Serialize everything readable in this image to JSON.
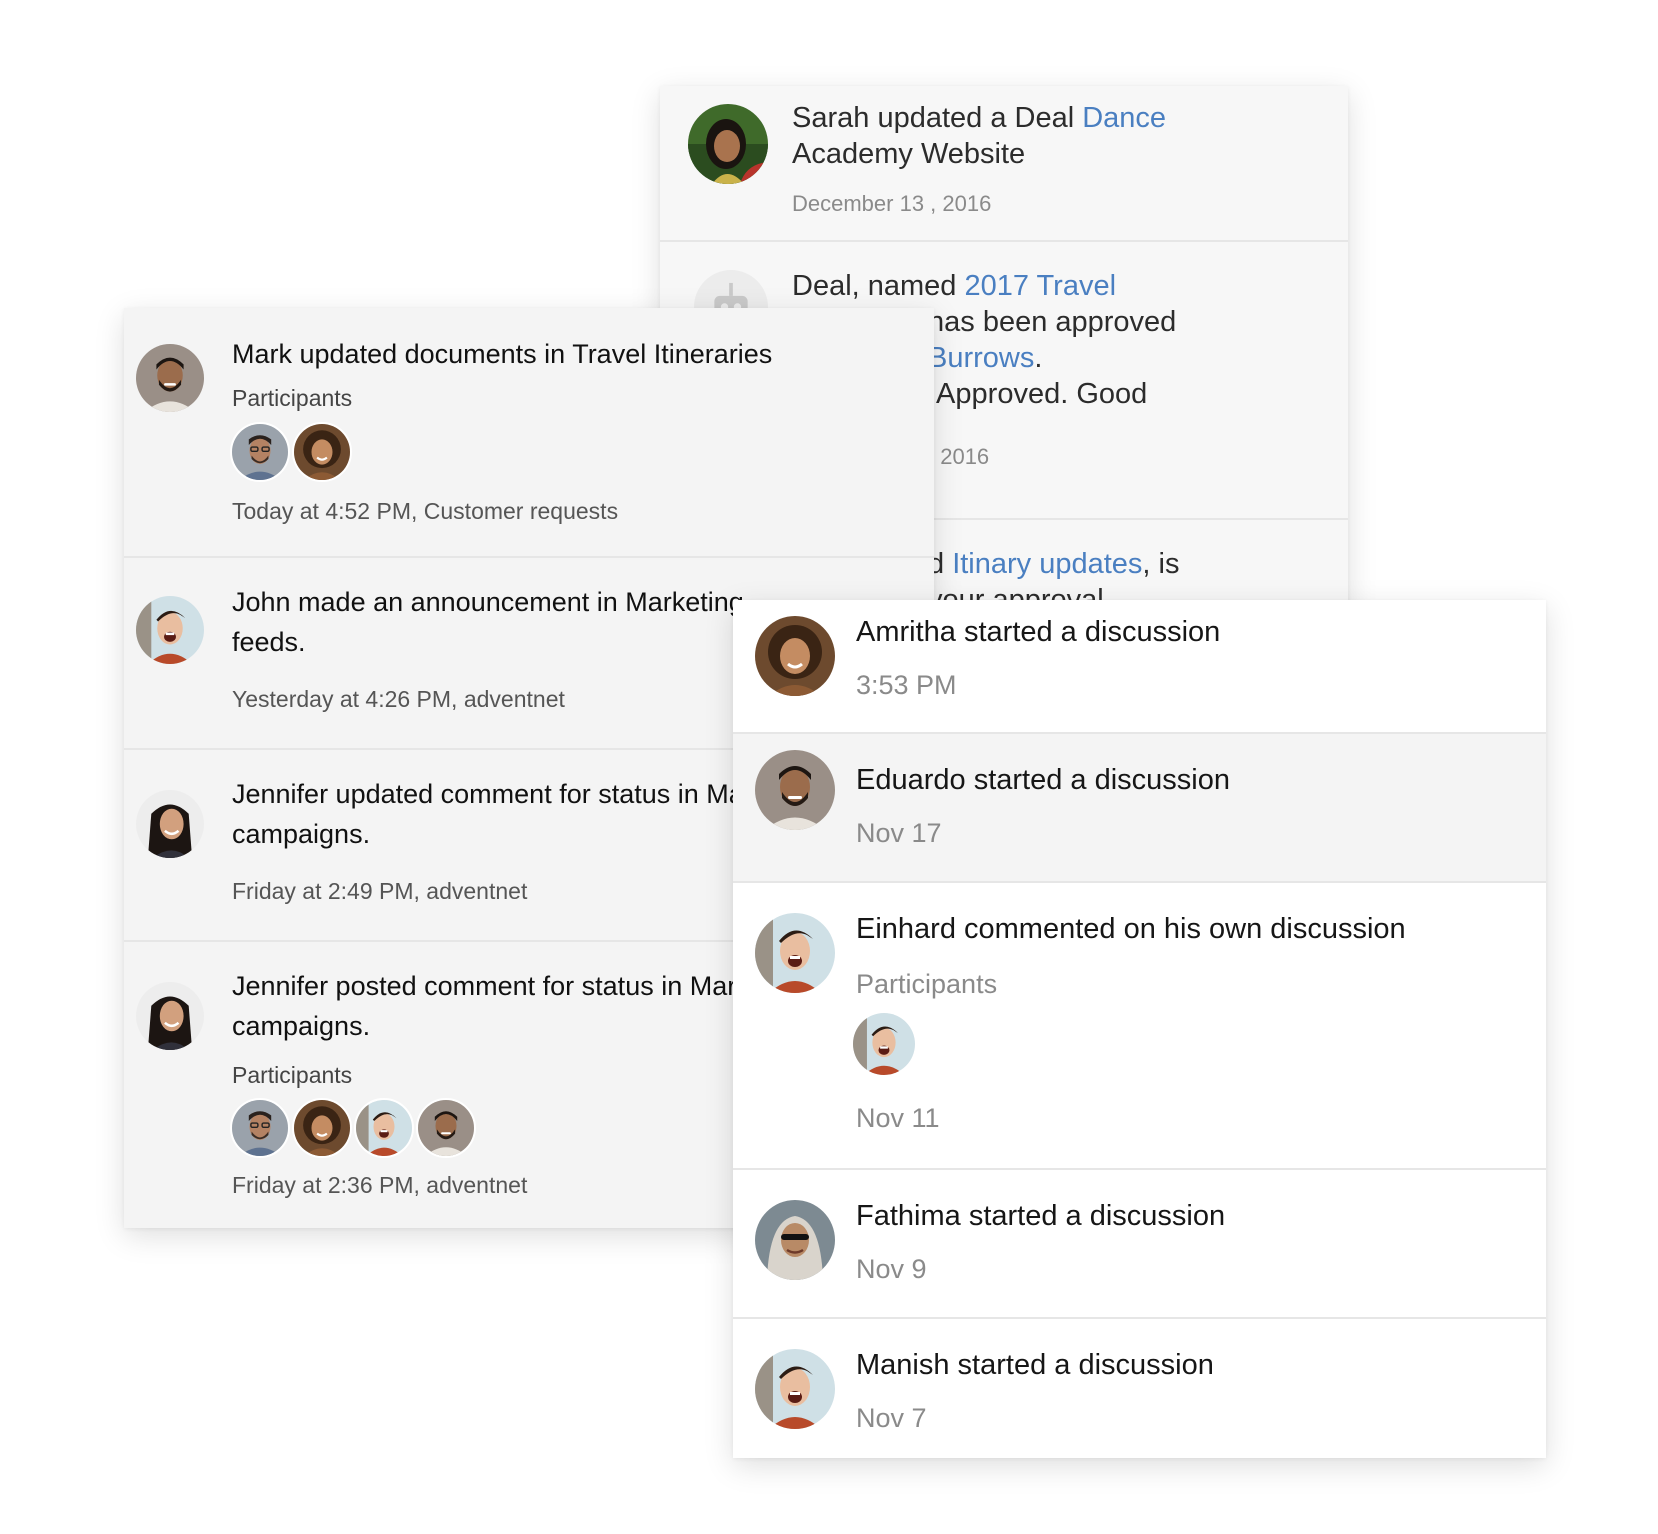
{
  "deals": [
    {
      "prefix": "Sarah updated a Deal ",
      "link_line1": "Dance",
      "link_line2": "Academy Website",
      "date": "December 13 , 2016"
    },
    {
      "line1_prefix": "Deal, named ",
      "line1_link": "2017 Travel",
      "line2": "has been approved",
      "line3_link": "Burrows",
      "line3_suffix": ".",
      "line4": ":Approved. Good",
      "date": ", 2016"
    },
    {
      "prefix": "d ",
      "link": "Itinary updates",
      "suffix": ", is",
      "line2": "your approval"
    }
  ],
  "activities": [
    {
      "line1": "Mark updated documents in Travel Itineraries",
      "participants_label": "Participants",
      "meta": "Today at 4:52 PM, Customer requests"
    },
    {
      "line1": "John made an announcement in Marketing",
      "line2": "feeds.",
      "meta": "Yesterday at 4:26 PM, adventnet"
    },
    {
      "line1": "Jennifer updated comment for status in Marketing",
      "line2": "campaigns.",
      "meta": "Friday at 2:49 PM, adventnet"
    },
    {
      "line1": "Jennifer posted comment for status in Marketing",
      "line2": "campaigns.",
      "participants_label": "Participants",
      "meta": "Friday at 2:36 PM, adventnet"
    }
  ],
  "discussions": [
    {
      "title": "Amritha started a discussion",
      "meta": "3:53 PM"
    },
    {
      "title": "Eduardo started a discussion",
      "meta": "Nov 17"
    },
    {
      "title": "Einhard commented on his own discussion",
      "participants_label": "Participants",
      "meta": "Nov 11"
    },
    {
      "title": "Fathima started a discussion",
      "meta": "Nov 9"
    },
    {
      "title": "Manish started a discussion",
      "meta": "Nov 7"
    }
  ],
  "colors": {
    "link": "#4a7fc1",
    "divider": "#e6e6e6",
    "deal_bg": "#f7f7f7",
    "activity_bg": "#f4f4f4"
  }
}
